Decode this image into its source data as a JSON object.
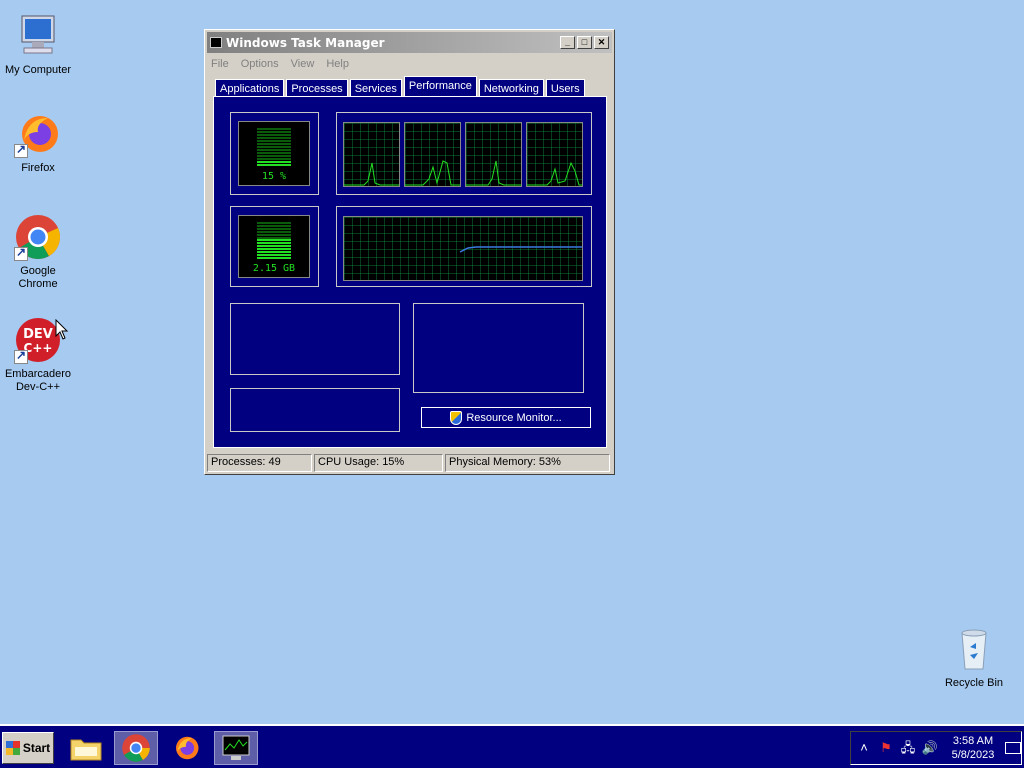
{
  "desktop": {
    "icons": [
      {
        "label": "My Computer"
      },
      {
        "label": "Firefox"
      },
      {
        "label": "Google Chrome"
      },
      {
        "label": "Embarcadero\nDev-C++"
      },
      {
        "label": "Recycle Bin"
      }
    ]
  },
  "window": {
    "title": "Windows Task Manager",
    "menu": [
      "File",
      "Options",
      "View",
      "Help"
    ],
    "tabs": [
      "Applications",
      "Processes",
      "Services",
      "Performance",
      "Networking",
      "Users"
    ],
    "active_tab": "Performance",
    "cpu_usage_meter": {
      "label": "15 %",
      "level_percent": 15
    },
    "memory_meter": {
      "label": "2.15 GB",
      "level_percent": 53
    },
    "resource_monitor_button": "Resource Monitor...",
    "status": {
      "processes": "Processes: 49",
      "cpu_usage": "CPU Usage: 15%",
      "physical_memory": "Physical Memory: 53%"
    }
  },
  "taskbar": {
    "start_label": "Start",
    "clock_time": "3:58 AM",
    "clock_date": "5/8/2023"
  },
  "colors": {
    "desktop": "#a6caf0",
    "panel": "#000080",
    "graph_line": "#22e022",
    "memory_line": "#3a7ae0"
  }
}
